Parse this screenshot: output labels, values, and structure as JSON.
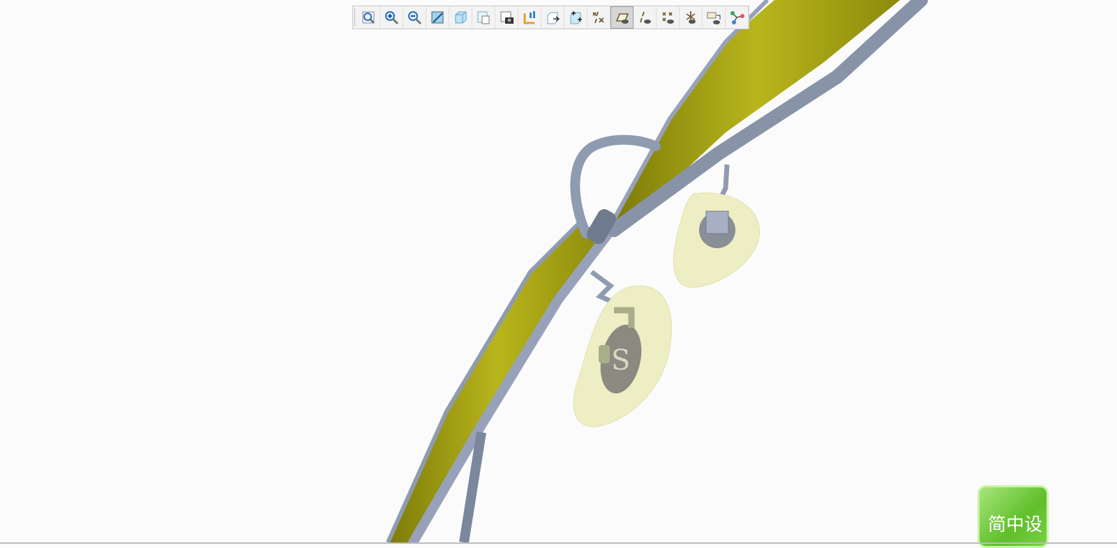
{
  "toolbar": {
    "buttons": [
      {
        "name": "refit",
        "icon": "refit-icon"
      },
      {
        "name": "zoom-in",
        "icon": "zoom-in-icon"
      },
      {
        "name": "zoom-out",
        "icon": "zoom-out-icon"
      },
      {
        "name": "repaint",
        "icon": "repaint-icon"
      },
      {
        "name": "display-style",
        "icon": "display-style-icon"
      },
      {
        "name": "saved-orientations",
        "icon": "saved-orientations-icon"
      },
      {
        "name": "view-manager",
        "icon": "view-manager-icon"
      },
      {
        "name": "plane-display",
        "icon": "plane-display-icon"
      },
      {
        "name": "reorient-view",
        "icon": "reorient-icon"
      },
      {
        "name": "spin-center",
        "icon": "spin-center-icon"
      },
      {
        "name": "datum-display-filters",
        "icon": "datum-filters-icon"
      },
      {
        "name": "plane-tag-display",
        "icon": "plane-tag-icon",
        "active": true
      },
      {
        "name": "axis-tag-display",
        "icon": "axis-tag-icon"
      },
      {
        "name": "point-tag-display",
        "icon": "point-tag-icon"
      },
      {
        "name": "csys-tag-display",
        "icon": "csys-tag-icon"
      },
      {
        "name": "annotation-display",
        "icon": "annotation-display-icon"
      },
      {
        "name": "spin-center-display",
        "icon": "spin-center-display-icon"
      }
    ]
  },
  "ime_indicator": {
    "text": "简中设",
    "color": "#6cc635"
  },
  "model": {
    "lens_color": "#a7a514",
    "frame_color": "#8f9bb0",
    "nosepad_color": "#eeeec4",
    "nosepad_logo": "S"
  }
}
